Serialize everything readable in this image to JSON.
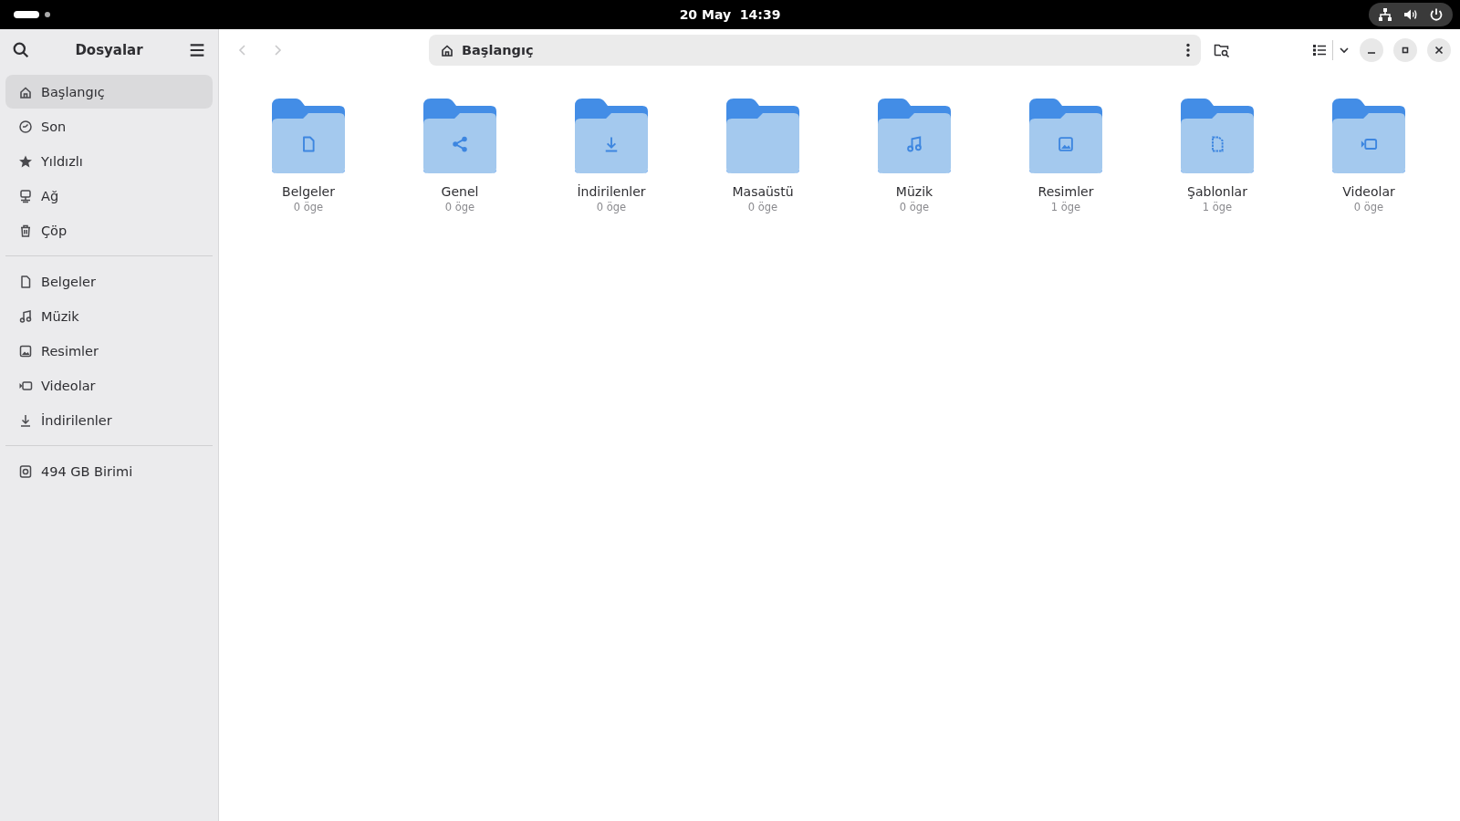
{
  "top_bar": {
    "clock": "20 May  14:39"
  },
  "sidebar": {
    "title": "Dosyalar",
    "sections": [
      [
        {
          "label": "Başlangıç",
          "selected": true
        },
        {
          "label": "Son",
          "selected": false
        },
        {
          "label": "Yıldızlı",
          "selected": false
        },
        {
          "label": "Ağ",
          "selected": false
        },
        {
          "label": "Çöp",
          "selected": false
        }
      ],
      [
        {
          "label": "Belgeler",
          "selected": false
        },
        {
          "label": "Müzik",
          "selected": false
        },
        {
          "label": "Resimler",
          "selected": false
        },
        {
          "label": "Videolar",
          "selected": false
        },
        {
          "label": "İndirilenler",
          "selected": false
        }
      ],
      [
        {
          "label": "494 GB Birimi",
          "selected": false
        }
      ]
    ]
  },
  "path_bar": {
    "location": "Başlangıç"
  },
  "folders": [
    {
      "name": "Belgeler",
      "count": "0 öge"
    },
    {
      "name": "Genel",
      "count": "0 öge"
    },
    {
      "name": "İndirilenler",
      "count": "0 öge"
    },
    {
      "name": "Masaüstü",
      "count": "0 öge"
    },
    {
      "name": "Müzik",
      "count": "0 öge"
    },
    {
      "name": "Resimler",
      "count": "1 öge"
    },
    {
      "name": "Şablonlar",
      "count": "1 öge"
    },
    {
      "name": "Videolar",
      "count": "0 öge"
    }
  ]
}
